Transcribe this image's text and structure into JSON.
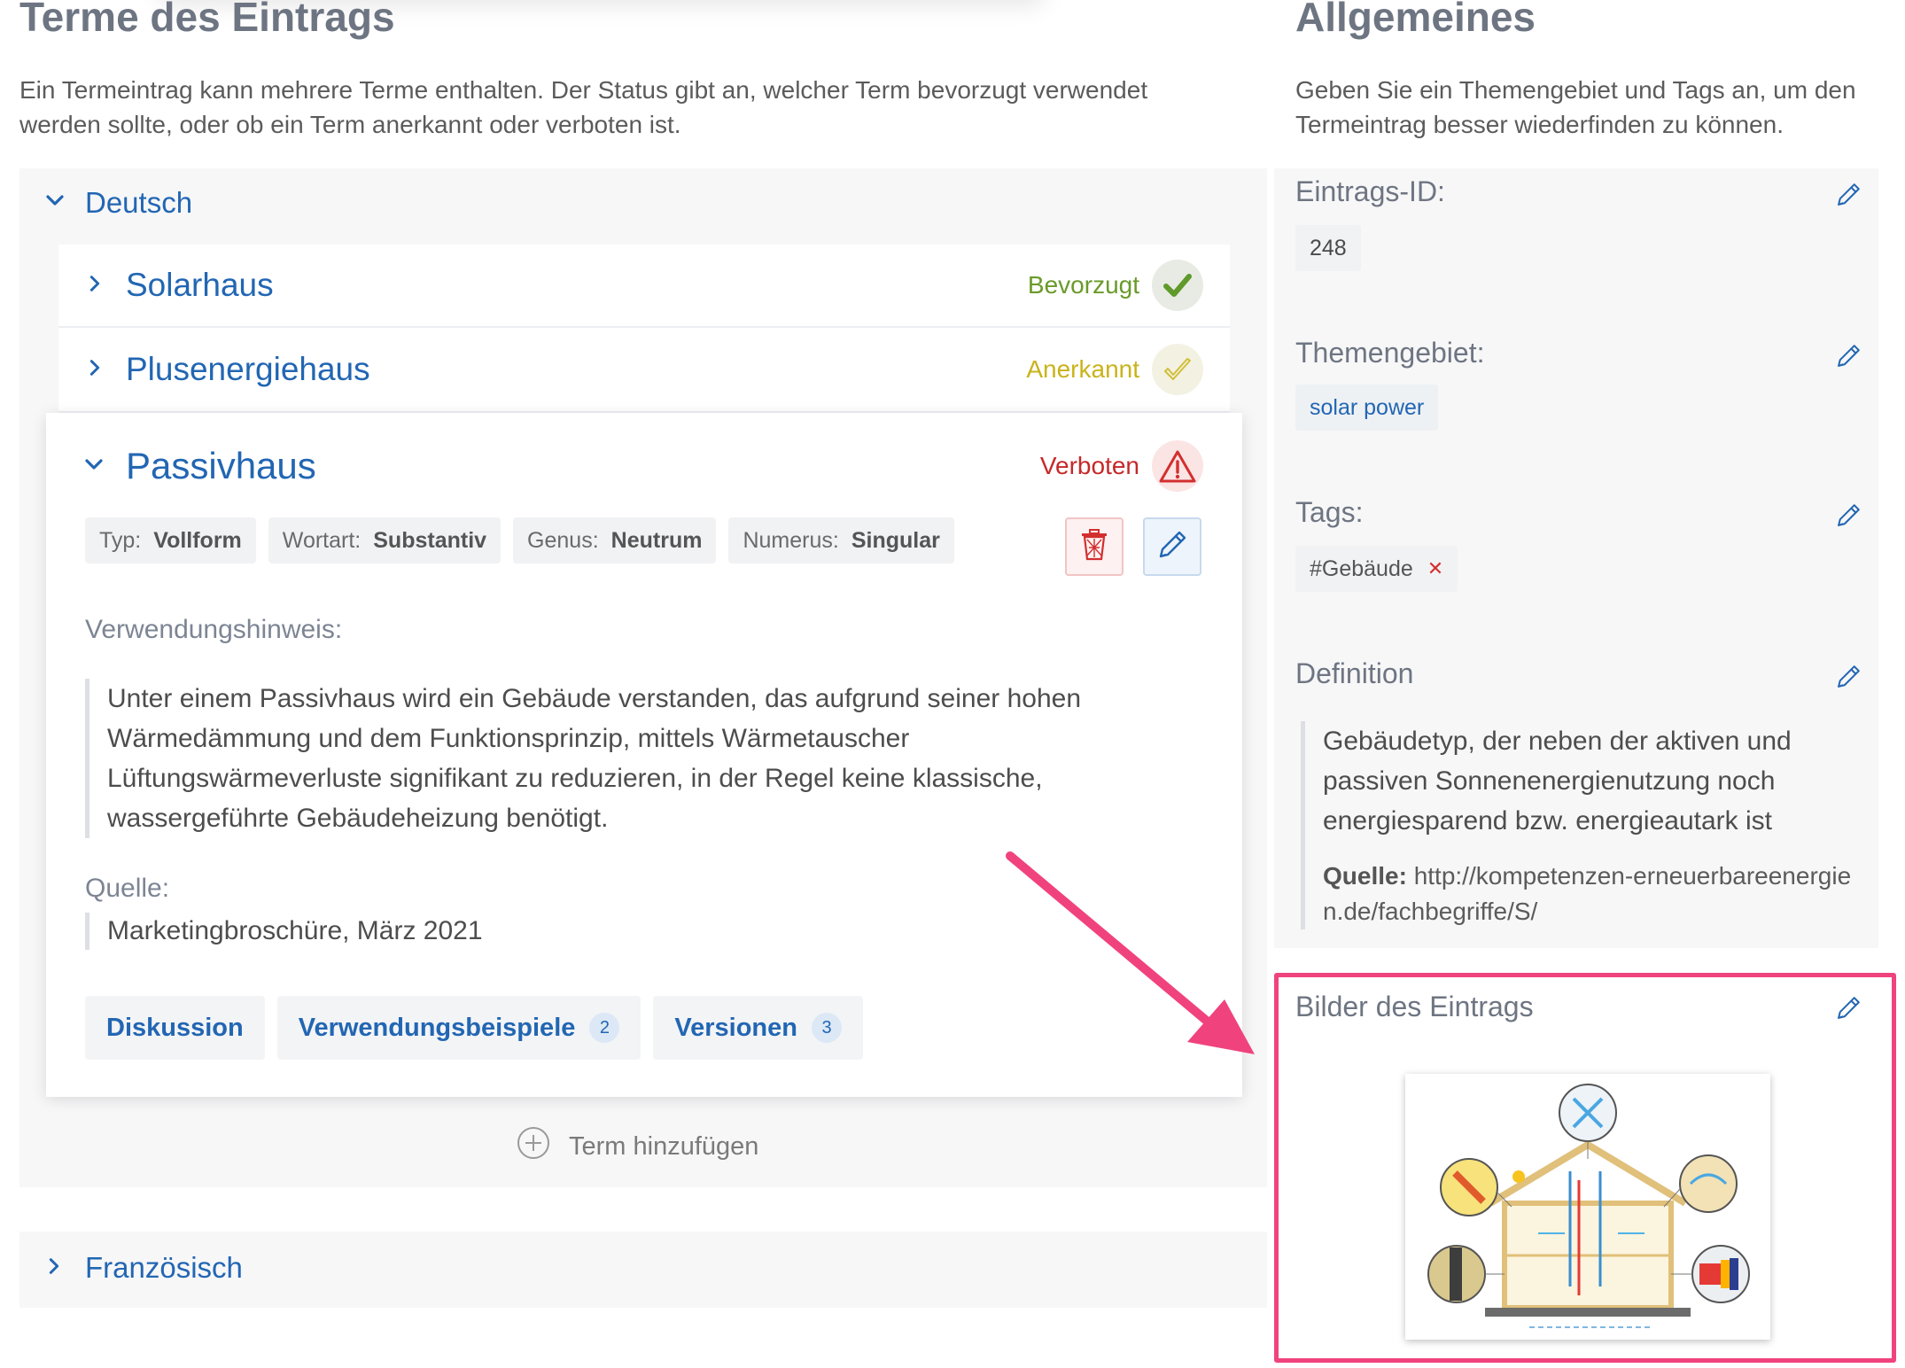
{
  "left": {
    "heading": "Terme des Eintrags",
    "intro": "Ein Termeintrag kann mehrere Terme enthalten. Der Status gibt an, welcher Term bevorzugt verwendet werden sollte, oder ob ein Term anerkannt oder verboten ist.",
    "language_de": "Deutsch",
    "language_fr": "Französisch",
    "terms": [
      {
        "name": "Solarhaus",
        "status": "Bevorzugt",
        "status_color": "#6a9a2a",
        "icon": "check-icon"
      },
      {
        "name": "Plusenergiehaus",
        "status": "Anerkannt",
        "status_color": "#c9b31a",
        "icon": "check-outline-icon"
      },
      {
        "name": "Passivhaus",
        "status": "Verboten",
        "status_color": "#c62828",
        "icon": "warning-triangle-icon"
      }
    ],
    "expanded": {
      "chips": [
        {
          "key": "Typ:",
          "value": "Vollform"
        },
        {
          "key": "Wortart:",
          "value": "Substantiv"
        },
        {
          "key": "Genus:",
          "value": "Neutrum"
        },
        {
          "key": "Numerus:",
          "value": "Singular"
        }
      ],
      "usage_label": "Verwendungshinweis:",
      "usage_text": "Unter einem Passivhaus wird ein Gebäude verstanden, das aufgrund seiner hohen Wärmedämmung und dem Funktionsprinzip, mittels Wärmetauscher Lüftungswärmeverluste signifikant zu reduzieren, in der Regel keine klassische, wassergeführte Gebäudeheizung benötigt.",
      "source_label": "Quelle:",
      "source_text": "Marketingbroschüre, März 2021",
      "tabs": [
        {
          "label": "Diskussion",
          "count": null
        },
        {
          "label": "Verwendungsbeispiele",
          "count": "2"
        },
        {
          "label": "Versionen",
          "count": "3"
        }
      ]
    },
    "add_term": "Term hinzufügen"
  },
  "right": {
    "heading": "Allgemeines",
    "intro": "Geben Sie ein Themengebiet und Tags an, um den Termeintrag besser wiederfinden zu können.",
    "entry_id_label": "Eintrags-ID:",
    "entry_id": "248",
    "topic_label": "Themengebiet:",
    "topic": "solar power",
    "tags_label": "Tags:",
    "tag": "#Gebäude",
    "definition_label": "Definition",
    "definition_text": "Gebäudetyp, der neben der aktiven und passiven Sonnenenergienutzung noch energiesparend bzw. energieautark ist",
    "definition_source_label": "Quelle:",
    "definition_source": "http://kompetenzen-erneuerbareenergien.de/fachbegriffe/S/",
    "images_label": "Bilder des Eintrags"
  },
  "colors": {
    "accent": "#2266b3",
    "highlight": "#f0437e"
  }
}
